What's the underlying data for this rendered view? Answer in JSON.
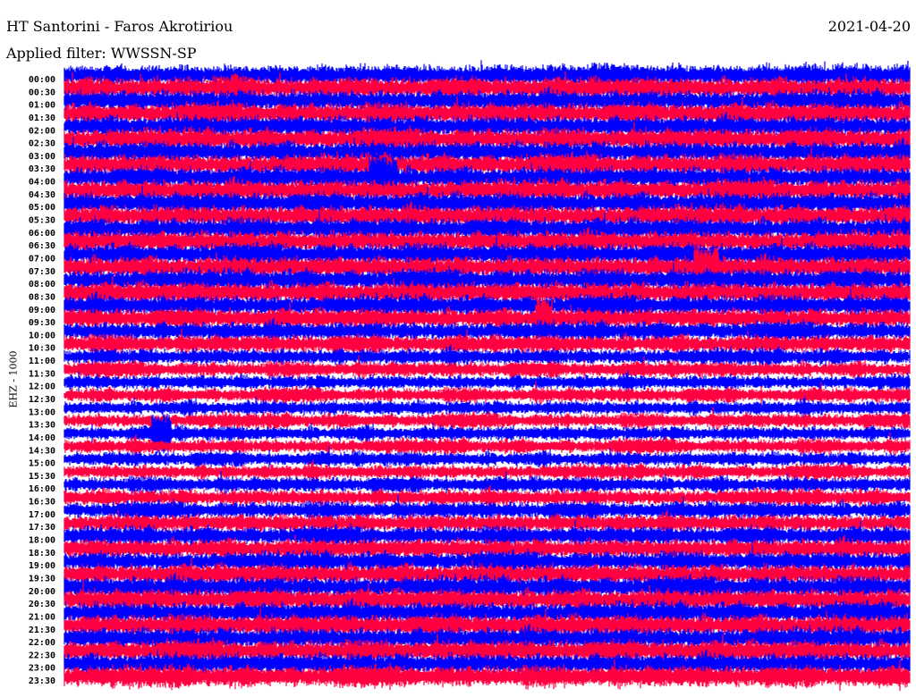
{
  "header": {
    "station": "HT Santorini - Faros Akrotiriou",
    "date": "2021-04-20",
    "filter": "Applied filter: WWSSN-SP"
  },
  "chart_data": {
    "type": "line",
    "subtype": "helicorder",
    "title": "HT Santorini - Faros Akrotiriou",
    "ylabel": "EHZ - 1000",
    "minutes_per_line": 30,
    "row_labels": [
      "00:00",
      "00:30",
      "01:00",
      "01:30",
      "02:00",
      "02:30",
      "03:00",
      "03:30",
      "04:00",
      "04:30",
      "05:00",
      "05:30",
      "06:00",
      "06:30",
      "07:00",
      "07:30",
      "08:00",
      "08:30",
      "09:00",
      "09:30",
      "10:00",
      "10:30",
      "11:00",
      "11:30",
      "12:00",
      "12:30",
      "13:00",
      "13:30",
      "14:00",
      "14:30",
      "15:00",
      "15:30",
      "16:00",
      "16:30",
      "17:00",
      "17:30",
      "18:00",
      "18:30",
      "19:00",
      "19:30",
      "20:00",
      "20:30",
      "21:00",
      "21:30",
      "22:00",
      "22:30",
      "23:00",
      "23:30"
    ],
    "row_noise_level": [
      1,
      1,
      1,
      1,
      1,
      1,
      1,
      1,
      1,
      1,
      1,
      1,
      1,
      1,
      1,
      1,
      1,
      1,
      0.95,
      0.9,
      0.85,
      0.8,
      0.7,
      0.65,
      0.6,
      0.6,
      0.6,
      0.6,
      0.6,
      0.6,
      0.6,
      0.6,
      0.65,
      0.7,
      0.75,
      0.8,
      0.85,
      0.9,
      0.9,
      0.95,
      1,
      1,
      1,
      1,
      1,
      1,
      1,
      1
    ],
    "colors": [
      "#0000ff",
      "#ff0040"
    ],
    "events": [
      {
        "row": "04:00",
        "minute": 10.8,
        "duration_min": 1.0,
        "amplitude": 1.8
      },
      {
        "row": "07:30",
        "minute": 22.3,
        "duration_min": 0.9,
        "amplitude": 1.8
      },
      {
        "row": "09:30",
        "minute": 16.7,
        "duration_min": 0.6,
        "amplitude": 1.8
      },
      {
        "row": "14:00",
        "minute": 3.1,
        "duration_min": 0.7,
        "amplitude": 1.6
      }
    ]
  }
}
